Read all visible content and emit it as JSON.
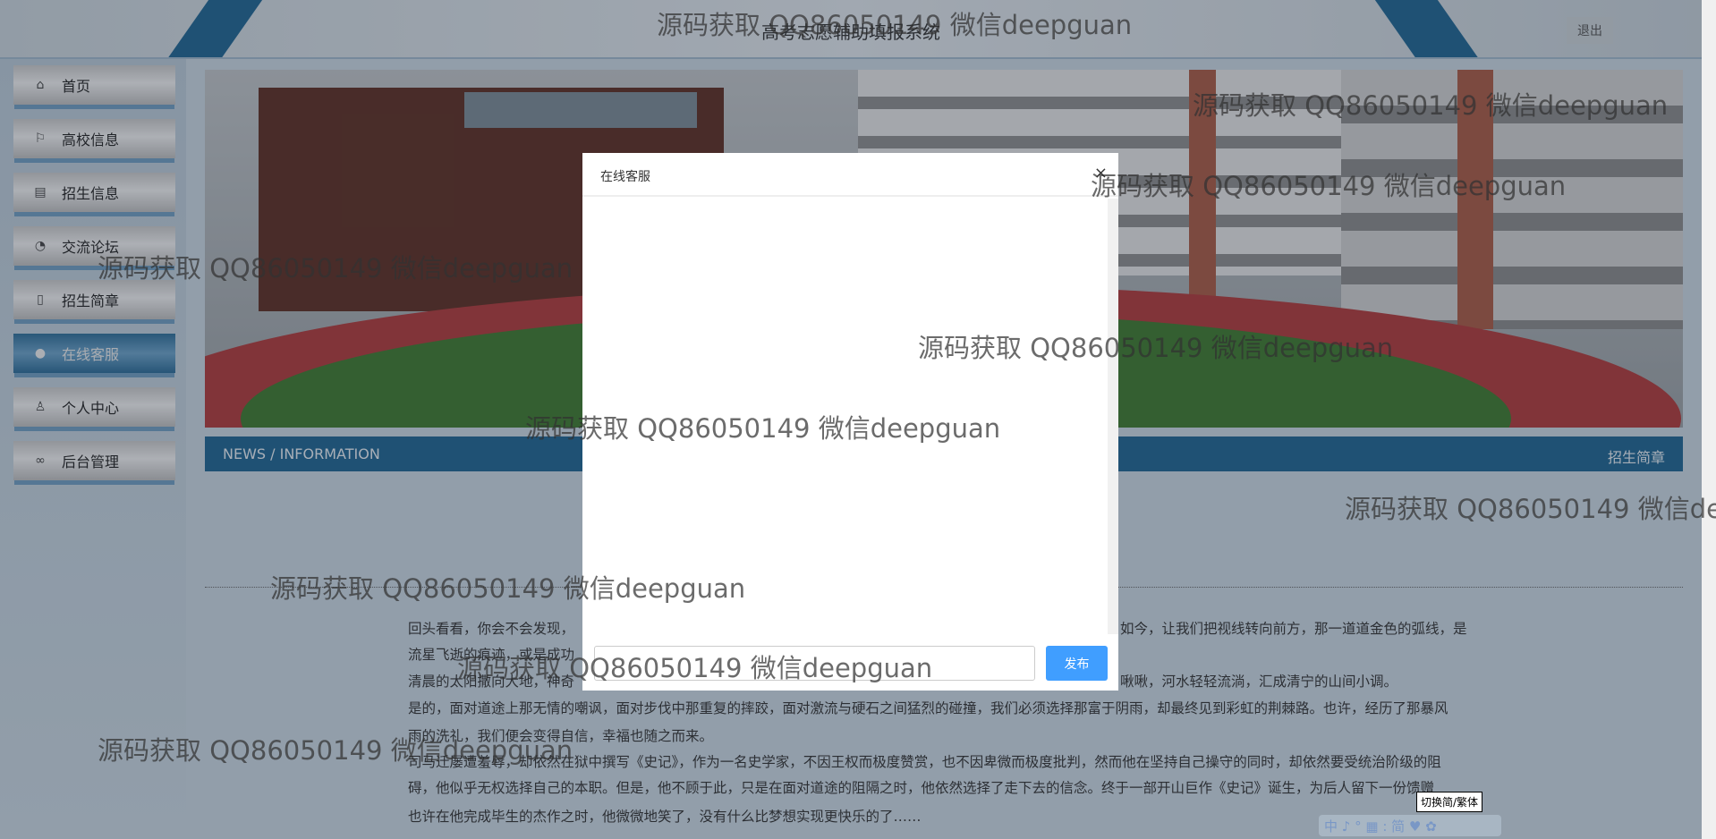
{
  "header": {
    "title": "高考志愿辅助填报系统",
    "logout": "退出"
  },
  "sidebar": {
    "items": [
      {
        "label": "首页",
        "icon": "home-icon",
        "glyph": "⌂"
      },
      {
        "label": "高校信息",
        "icon": "flag-icon",
        "glyph": "⚐"
      },
      {
        "label": "招生信息",
        "icon": "clipboard-icon",
        "glyph": "▤"
      },
      {
        "label": "交流论坛",
        "icon": "palette-icon",
        "glyph": "◔"
      },
      {
        "label": "招生简章",
        "icon": "map-icon",
        "glyph": "▯"
      },
      {
        "label": "在线客服",
        "icon": "chat-icon",
        "glyph": "●",
        "active": true
      },
      {
        "label": "个人中心",
        "icon": "user-icon",
        "glyph": "♙"
      },
      {
        "label": "后台管理",
        "icon": "link-icon",
        "glyph": "∞"
      }
    ]
  },
  "news": {
    "left": "NEWS / INFORMATION",
    "right": "招生简章"
  },
  "article": {
    "lines": [
      {
        "left": "回头看看，你会不会发现，",
        "right": "如今，让我们把视线转向前方，那一道道金色的弧线，是"
      },
      {
        "left": "流星飞逝的痕迹，或是成功",
        "right": ""
      },
      {
        "left": "清晨的太阳撒向大地，神奇",
        "right": "啾啾，河水轻轻流淌，汇成清宁的山间小调。"
      },
      {
        "left": "是的，面对道途上那无情的嘲讽，面对步伐中那重复的摔跤，面对激流与硬石之间猛烈的碰撞，我们必须选择那富于阴雨，却最终见到彩虹的荆棘路。也许，经历了那暴风",
        "right": ""
      },
      {
        "left": "雨的洗礼，我们便会变得自信，幸福也随之而来。",
        "right": ""
      },
      {
        "left": "司马迁屡遭羞辱，却依然在狱中撰写《史记》，作为一名史学家，不因王权而极度赞赏，也不因卑微而极度批判，然而他在坚持自己操守的同时，却依然要受统治阶级的阻",
        "right": ""
      },
      {
        "left": "碍，他似乎无权选择自己的本职。但是，他不顾于此，只是在面对道途的阻隔之时，他依然选择了走下去的信念。终于一部开山巨作《史记》诞生，为后人留下一份馈赠",
        "right": ""
      },
      {
        "left": "也许在他完成毕生的杰作之时，他微微地笑了，没有什么比梦想实现更快乐的了……",
        "right": ""
      }
    ]
  },
  "modal": {
    "title": "在线客服",
    "close": "×",
    "input_value": "",
    "send": "发布"
  },
  "translate": {
    "tooltip": "切换简/繁体",
    "toolbar": "中 ♪ ° ▦ : 简 ♥ ✿"
  },
  "watermark": "源码获取 QQ86050149 微信deepguan",
  "colors": {
    "primary": "#1f6591",
    "send_button": "#409eff"
  }
}
